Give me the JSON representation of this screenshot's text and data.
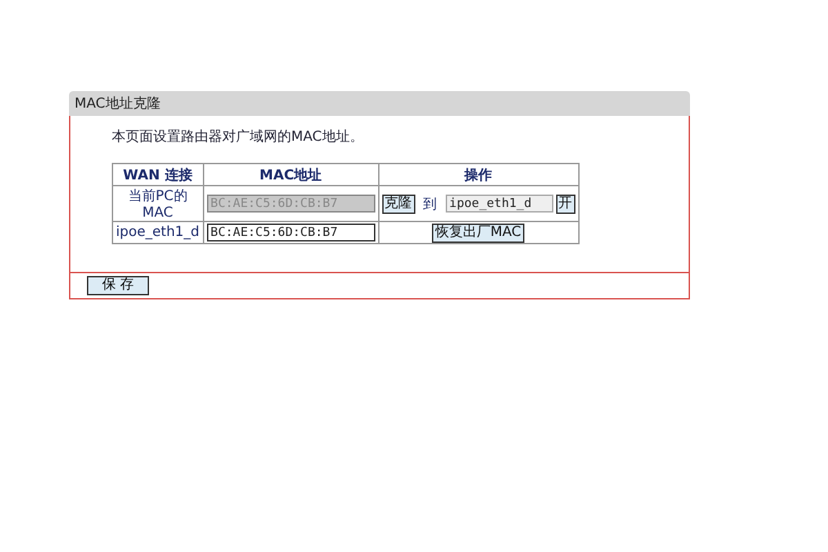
{
  "panel": {
    "title": "MAC地址克隆",
    "description": "本页面设置路由器对广域网的MAC地址。"
  },
  "table": {
    "columns": [
      "WAN 连接",
      "MAC地址",
      "操作"
    ],
    "rows": [
      {
        "kind": "clone",
        "label": "当前PC的MAC",
        "mac": "BC:AE:C5:6D:CB:B7",
        "disabled": true,
        "clone_button": "克隆",
        "to_label": "到",
        "target": "ipoe_eth1_d",
        "dropdown_button": "开"
      },
      {
        "kind": "restore",
        "label": "ipoe_eth1_d",
        "mac": "BC:AE:C5:6D:CB:B7",
        "disabled": false,
        "restore_button": "恢复出厂MAC"
      }
    ]
  },
  "save_button": "保 存"
}
